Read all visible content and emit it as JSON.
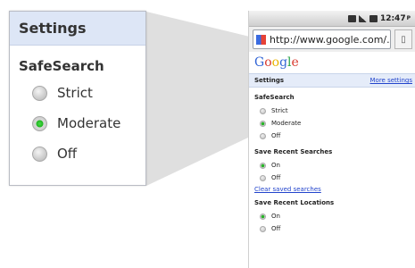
{
  "callout": {
    "header": "Settings",
    "section": "SafeSearch",
    "options": [
      {
        "label": "Strict",
        "selected": false
      },
      {
        "label": "Moderate",
        "selected": true
      },
      {
        "label": "Off",
        "selected": false
      }
    ]
  },
  "phone": {
    "status_time": "12:47",
    "status_suffix": "P",
    "url": "http://www.google.com/...",
    "bookmark_icon": "bookmark-icon",
    "logo": {
      "G": "G",
      "o1": "o",
      "o2": "o",
      "g": "g",
      "l": "l",
      "e": "e"
    },
    "settings_title": "Settings",
    "more_settings": "More settings",
    "safesearch": {
      "title": "SafeSearch",
      "options": [
        {
          "label": "Strict",
          "selected": false
        },
        {
          "label": "Moderate",
          "selected": true
        },
        {
          "label": "Off",
          "selected": false
        }
      ]
    },
    "recent_searches": {
      "title": "Save Recent Searches",
      "options": [
        {
          "label": "On",
          "selected": true
        },
        {
          "label": "Off",
          "selected": false
        }
      ],
      "link": "Clear saved searches"
    },
    "recent_locations": {
      "title": "Save Recent Locations",
      "options": [
        {
          "label": "On",
          "selected": true
        },
        {
          "label": "Off",
          "selected": false
        }
      ]
    }
  },
  "colors": {
    "selected_radio": "#1fb51f",
    "header_bg": "#dde6f6",
    "link": "#2244cc"
  }
}
